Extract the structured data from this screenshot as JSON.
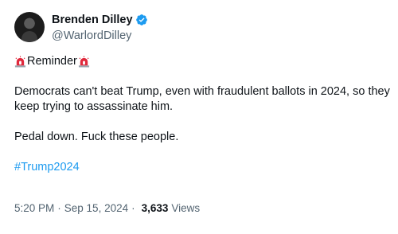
{
  "author": {
    "display_name": "Brenden Dilley",
    "handle": "@WarlordDilley",
    "verified": true,
    "verified_color": "#1d9bf0"
  },
  "tweet": {
    "reminder_label": "Reminder",
    "reminder_icon": "police-siren-icon",
    "paragraph_1": "Democrats can't beat Trump, even with fraudulent ballots in 2024, so they keep trying to assassinate him.",
    "paragraph_2": "Pedal down. Fuck these people.",
    "hashtag": "#Trump2024"
  },
  "meta": {
    "time": "5:20 PM",
    "separator": "·",
    "date": "Sep 15, 2024",
    "views_count": "3,633",
    "views_label": "Views"
  },
  "colors": {
    "text": "#0f1419",
    "secondary": "#536471",
    "link": "#1d9bf0",
    "siren_red": "#e0293c"
  }
}
